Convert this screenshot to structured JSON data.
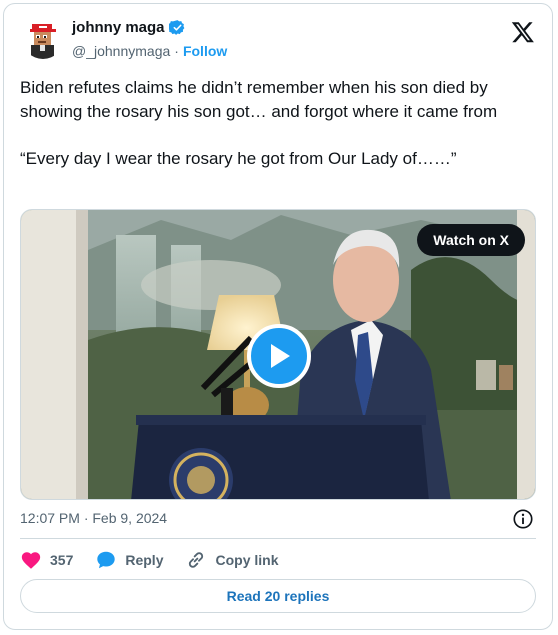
{
  "author": {
    "display_name": "johnny maga",
    "handle": "@_johnnymaga",
    "separator": "·",
    "follow_label": "Follow",
    "verified": true,
    "avatar_icon": "pixel-avatar-red-cap-icon"
  },
  "brand_icon": "x-logo-icon",
  "tweet": {
    "text": "Biden refutes claims he didn’t remember when his son died by showing the rosary his son got… and forgot where it came from\n\n“Every day I wear the rosary he got from Our Lady of……”"
  },
  "media": {
    "watch_label": "Watch on X",
    "play_icon": "play-icon"
  },
  "meta": {
    "timestamp": "12:07 PM · Feb 9, 2024",
    "info_icon": "info-icon"
  },
  "actions": {
    "like_count": "357",
    "reply_label": "Reply",
    "copy_label": "Copy link"
  },
  "replies_button": "Read 20 replies",
  "colors": {
    "accent": "#1d9bf0",
    "like": "#f91880",
    "text": "#0f1419",
    "secondary": "#536471",
    "border": "#cfd9de"
  }
}
